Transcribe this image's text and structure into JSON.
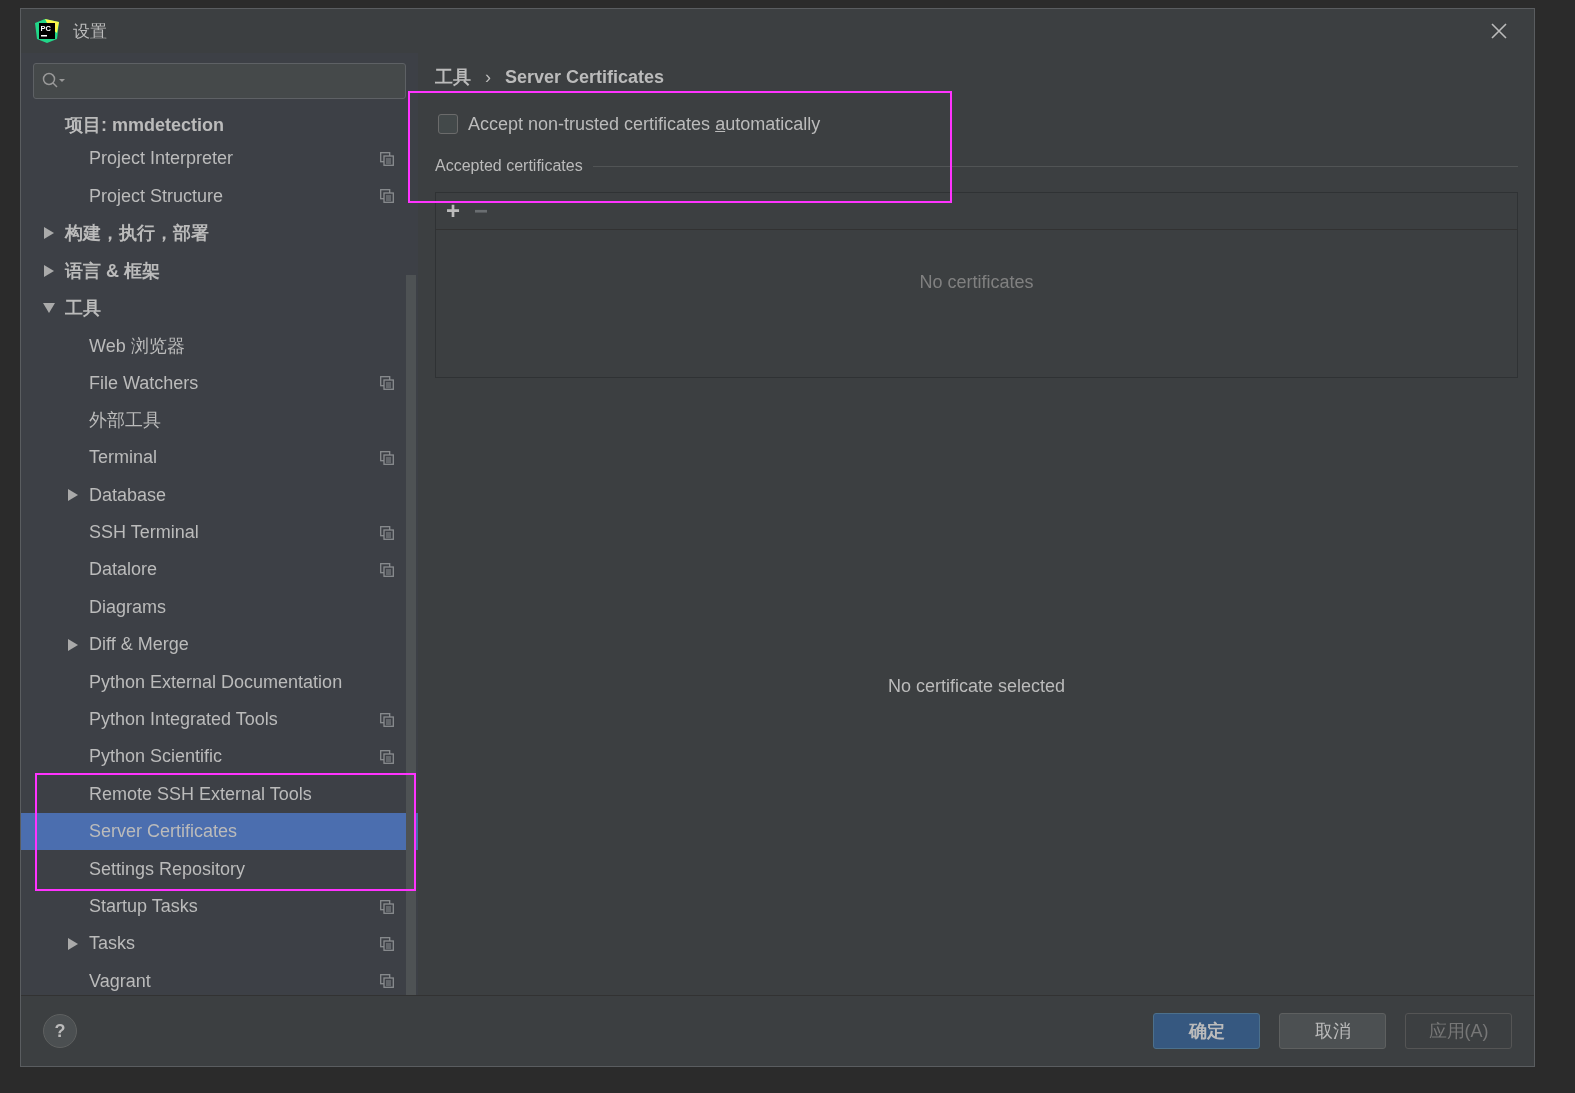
{
  "window": {
    "logo_text": "PC",
    "title": "设置"
  },
  "sidebar": {
    "items": [
      {
        "label": "项目: mmdetection",
        "kind": "header",
        "selected": false,
        "children": [
          {
            "label": "Project Interpreter",
            "kind": "page",
            "selected": false,
            "project_level": true
          },
          {
            "label": "Project Structure",
            "kind": "page",
            "selected": false,
            "project_level": true
          }
        ]
      },
      {
        "label": "构建，执行，部署",
        "kind": "group",
        "selected": false,
        "expanded": false
      },
      {
        "label": "语言 & 框架",
        "kind": "group",
        "selected": false,
        "expanded": false
      },
      {
        "label": "工具",
        "kind": "group",
        "selected": false,
        "expanded": true,
        "children": [
          {
            "label": "Web 浏览器",
            "kind": "page",
            "selected": false,
            "project_level": false
          },
          {
            "label": "File Watchers",
            "kind": "page",
            "selected": false,
            "project_level": true
          },
          {
            "label": "外部工具",
            "kind": "page",
            "selected": false,
            "project_level": false
          },
          {
            "label": "Terminal",
            "kind": "page",
            "selected": false,
            "project_level": true
          },
          {
            "label": "Database",
            "kind": "page",
            "selected": false,
            "project_level": false,
            "expanded": false
          },
          {
            "label": "SSH Terminal",
            "kind": "page",
            "selected": false,
            "project_level": true
          },
          {
            "label": "Datalore",
            "kind": "page",
            "selected": false,
            "project_level": true
          },
          {
            "label": "Diagrams",
            "kind": "page",
            "selected": false,
            "project_level": false
          },
          {
            "label": "Diff & Merge",
            "kind": "page",
            "selected": false,
            "project_level": false,
            "expanded": false
          },
          {
            "label": "Python External Documentation",
            "kind": "page",
            "selected": false,
            "project_level": false
          },
          {
            "label": "Python Integrated Tools",
            "kind": "page",
            "selected": false,
            "project_level": true
          },
          {
            "label": "Python Scientific",
            "kind": "page",
            "selected": false,
            "project_level": true
          },
          {
            "label": "Remote SSH External Tools",
            "kind": "page",
            "selected": false,
            "project_level": false,
            "framed": true
          },
          {
            "label": "Server Certificates",
            "kind": "page",
            "selected": true,
            "project_level": false,
            "framed": true
          },
          {
            "label": "Settings Repository",
            "kind": "page",
            "selected": false,
            "project_level": false,
            "framed": true
          },
          {
            "label": "Startup Tasks",
            "kind": "page",
            "selected": false,
            "project_level": true
          },
          {
            "label": "Tasks",
            "kind": "page",
            "selected": false,
            "project_level": true,
            "expanded": false
          },
          {
            "label": "Vagrant",
            "kind": "page",
            "selected": false,
            "project_level": true
          }
        ]
      }
    ]
  },
  "content": {
    "breadcrumb": [
      "工具",
      "Server Certificates"
    ],
    "breadcrumb_separator": "›",
    "framed": true,
    "checkbox": {
      "label_before": "Accept non-trusted certificates ",
      "mnemonic": "a",
      "label_after": "utomatically",
      "checked": false
    },
    "section_title": "Accepted certificates",
    "toolbar": [
      {
        "symbol": "+",
        "disabled": false
      },
      {
        "symbol": "−",
        "disabled": true
      }
    ],
    "empty_list": "No certificates",
    "detail_empty": "No certificate selected"
  },
  "footer": {
    "help": "?",
    "buttons": [
      {
        "label": "确定",
        "kind": "default",
        "disabled": false
      },
      {
        "label": "取消",
        "kind": "normal",
        "disabled": false
      },
      {
        "label": "应用(A)",
        "kind": "normal",
        "disabled": true
      }
    ]
  }
}
